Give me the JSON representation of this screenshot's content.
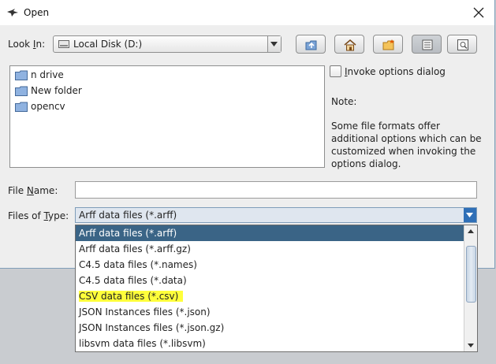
{
  "window": {
    "title": "Open",
    "icon": "weka-bird-icon",
    "close_icon": "close-icon"
  },
  "look_in": {
    "label_pre": "Look ",
    "label_mnemonic": "I",
    "label_post": "n:",
    "value": "Local Disk (D:)",
    "icon": "drive-icon"
  },
  "toolbar": {
    "buttons": [
      {
        "name": "up-one-level-button",
        "icon": "up-folder-icon"
      },
      {
        "name": "home-button",
        "icon": "home-icon"
      },
      {
        "name": "new-folder-button",
        "icon": "new-folder-icon"
      },
      {
        "name": "list-view-button",
        "icon": "list-view-icon",
        "active": true
      },
      {
        "name": "details-view-button",
        "icon": "details-view-icon"
      }
    ]
  },
  "files": [
    {
      "name": "n drive",
      "icon": "folder-icon"
    },
    {
      "name": "New folder",
      "icon": "folder-icon"
    },
    {
      "name": "opencv",
      "icon": "folder-icon"
    }
  ],
  "options": {
    "invoke_label_mnemonic": "I",
    "invoke_label_rest": "nvoke options dialog",
    "invoke_checked": false,
    "note_title": "Note:",
    "note_body": "Some file formats offer additional options which can be customized when invoking the options dialog."
  },
  "file_name": {
    "label_pre": "File ",
    "label_mnemonic": "N",
    "label_post": "ame:",
    "value": ""
  },
  "files_of_type": {
    "label_pre": "Files of ",
    "label_mnemonic": "T",
    "label_post": "ype:",
    "value": "Arff data files (*.arff)",
    "options": [
      "Arff data files (*.arff)",
      "Arff data files (*.arff.gz)",
      "C4.5 data files (*.names)",
      "C4.5 data files (*.data)",
      "CSV data files (*.csv)",
      "JSON Instances files (*.json)",
      "JSON Instances files (*.json.gz)",
      "libsvm data files (*.libsvm)"
    ],
    "selected_index": 0,
    "highlighted_index": 4
  },
  "colors": {
    "selection": "#3a6486",
    "highlight": "#ffff3b",
    "accent": "#2f6fb7"
  }
}
